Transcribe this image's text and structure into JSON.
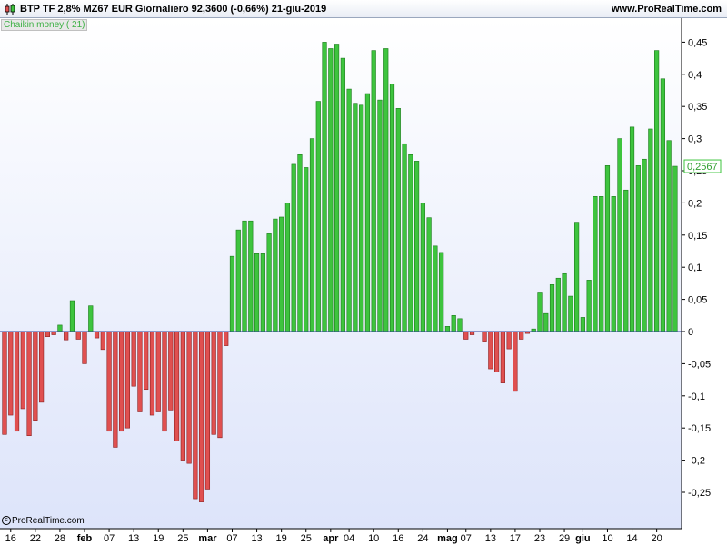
{
  "header": {
    "title": "BTP TF 2,8% MZ67 EUR   Giornaliero   92,3600 (-0,66%)   21-giu-2019",
    "site": "www.ProRealTime.com"
  },
  "indicator": {
    "label": "Chaikin money ( 21)"
  },
  "footer": {
    "copyright": "ProRealTime.com"
  },
  "colors": {
    "positive": "#3ec43e",
    "negative": "#e05050",
    "bg_top": "#ffffff",
    "bg_bottom": "#dde4fa"
  },
  "chart_data": {
    "type": "bar",
    "title": "",
    "xlabel": "",
    "ylabel": "",
    "ylim": [
      -0.3,
      0.46
    ],
    "grid": false,
    "last_value_label": "0,2567",
    "y_ticks": [
      {
        "v": 0.45,
        "t": "0,45"
      },
      {
        "v": 0.4,
        "t": "0,4"
      },
      {
        "v": 0.35,
        "t": "0,35"
      },
      {
        "v": 0.3,
        "t": "0,3"
      },
      {
        "v": 0.25,
        "t": "0,25"
      },
      {
        "v": 0.2,
        "t": "0,2"
      },
      {
        "v": 0.15,
        "t": "0,15"
      },
      {
        "v": 0.1,
        "t": "0,1"
      },
      {
        "v": 0.05,
        "t": "0,05"
      },
      {
        "v": 0,
        "t": "0"
      },
      {
        "v": -0.05,
        "t": "-0,05"
      },
      {
        "v": -0.1,
        "t": "-0,1"
      },
      {
        "v": -0.15,
        "t": "-0,15"
      },
      {
        "v": -0.2,
        "t": "-0,2"
      },
      {
        "v": -0.25,
        "t": "-0,25"
      }
    ],
    "x_ticks": [
      {
        "i": 1,
        "t": "16",
        "b": false
      },
      {
        "i": 5,
        "t": "22",
        "b": false
      },
      {
        "i": 9,
        "t": "28",
        "b": false
      },
      {
        "i": 13,
        "t": "feb",
        "b": true
      },
      {
        "i": 17,
        "t": "07",
        "b": false
      },
      {
        "i": 21,
        "t": "13",
        "b": false
      },
      {
        "i": 25,
        "t": "19",
        "b": false
      },
      {
        "i": 29,
        "t": "25",
        "b": false
      },
      {
        "i": 33,
        "t": "mar",
        "b": true
      },
      {
        "i": 37,
        "t": "07",
        "b": false
      },
      {
        "i": 41,
        "t": "13",
        "b": false
      },
      {
        "i": 45,
        "t": "19",
        "b": false
      },
      {
        "i": 49,
        "t": "25",
        "b": false
      },
      {
        "i": 53,
        "t": "apr",
        "b": true
      },
      {
        "i": 56,
        "t": "04",
        "b": false
      },
      {
        "i": 60,
        "t": "10",
        "b": false
      },
      {
        "i": 64,
        "t": "16",
        "b": false
      },
      {
        "i": 68,
        "t": "24",
        "b": false
      },
      {
        "i": 72,
        "t": "mag",
        "b": true
      },
      {
        "i": 75,
        "t": "07",
        "b": false
      },
      {
        "i": 79,
        "t": "13",
        "b": false
      },
      {
        "i": 83,
        "t": "17",
        "b": false
      },
      {
        "i": 87,
        "t": "23",
        "b": false
      },
      {
        "i": 91,
        "t": "29",
        "b": false
      },
      {
        "i": 94,
        "t": "giu",
        "b": true
      },
      {
        "i": 98,
        "t": "10",
        "b": false
      },
      {
        "i": 102,
        "t": "14",
        "b": false
      },
      {
        "i": 106,
        "t": "20",
        "b": false
      }
    ],
    "values": [
      -0.16,
      -0.13,
      -0.155,
      -0.12,
      -0.162,
      -0.138,
      -0.11,
      -0.008,
      -0.005,
      0.01,
      -0.013,
      0.048,
      -0.012,
      -0.05,
      0.04,
      -0.01,
      -0.028,
      -0.155,
      -0.18,
      -0.155,
      -0.15,
      -0.085,
      -0.125,
      -0.09,
      -0.13,
      -0.125,
      -0.155,
      -0.122,
      -0.17,
      -0.2,
      -0.205,
      -0.26,
      -0.265,
      -0.245,
      -0.16,
      -0.165,
      -0.022,
      0.117,
      0.158,
      0.172,
      0.172,
      0.121,
      0.121,
      0.152,
      0.175,
      0.178,
      0.2,
      0.26,
      0.275,
      0.255,
      0.3,
      0.358,
      0.45,
      0.44,
      0.447,
      0.425,
      0.377,
      0.355,
      0.352,
      0.37,
      0.437,
      0.36,
      0.44,
      0.385,
      0.347,
      0.292,
      0.275,
      0.265,
      0.2,
      0.177,
      0.133,
      0.123,
      0.008,
      0.025,
      0.02,
      -0.012,
      -0.005,
      0,
      -0.015,
      -0.058,
      -0.063,
      -0.08,
      -0.027,
      -0.093,
      -0.012,
      -0.003,
      0.004,
      0.06,
      0.028,
      0.073,
      0.083,
      0.09,
      0.055,
      0.17,
      0.022,
      0.08,
      0.21,
      0.21,
      0.258,
      0.21,
      0.3,
      0.22,
      0.318,
      0.258,
      0.268,
      0.315,
      0.437,
      0.393,
      0.297,
      0.257
    ]
  }
}
